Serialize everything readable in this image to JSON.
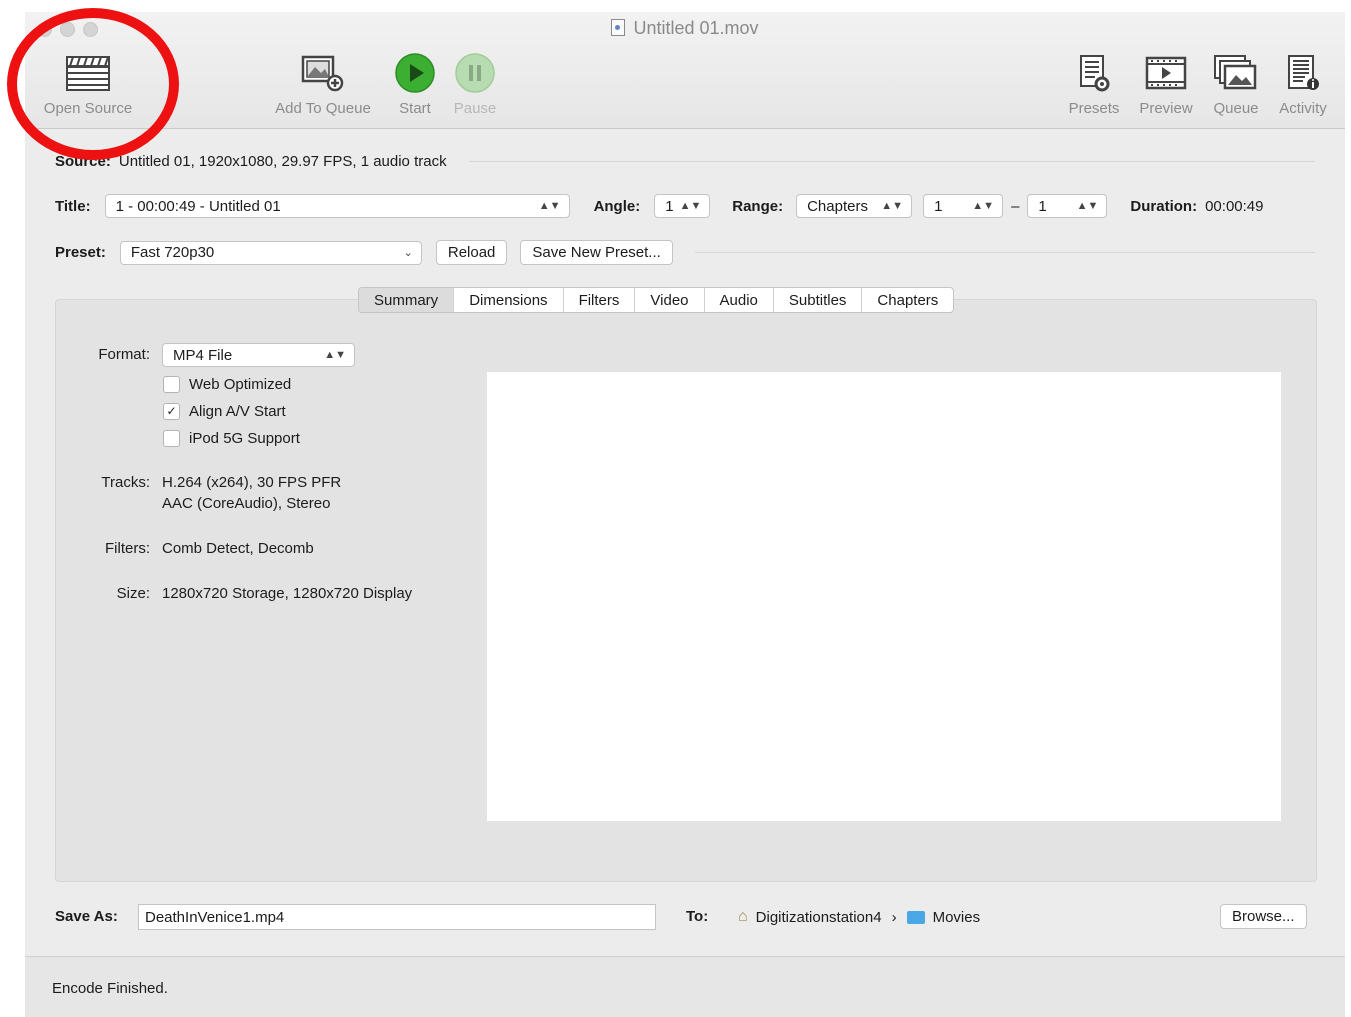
{
  "window": {
    "title": "Untitled 01.mov"
  },
  "toolbar": {
    "open_source": "Open Source",
    "add_to_queue": "Add To Queue",
    "start": "Start",
    "pause": "Pause",
    "presets": "Presets",
    "preview": "Preview",
    "queue": "Queue",
    "activity": "Activity"
  },
  "source": {
    "label": "Source:",
    "text": "Untitled 01, 1920x1080, 29.97 FPS, 1 audio track"
  },
  "title_row": {
    "title_label": "Title:",
    "title_value": "1 - 00:00:49 - Untitled 01",
    "angle_label": "Angle:",
    "angle_value": "1",
    "range_label": "Range:",
    "range_value": "Chapters",
    "range_start": "1",
    "range_dash": "–",
    "range_end": "1",
    "duration_label": "Duration:",
    "duration_value": "00:00:49"
  },
  "preset_row": {
    "preset_label": "Preset:",
    "preset_value": "Fast 720p30",
    "reload": "Reload",
    "save_new_preset": "Save New Preset..."
  },
  "tabs": [
    "Summary",
    "Dimensions",
    "Filters",
    "Video",
    "Audio",
    "Subtitles",
    "Chapters"
  ],
  "active_tab": "Summary",
  "summary": {
    "format_label": "Format:",
    "format_value": "MP4 File",
    "web_optimized": {
      "label": "Web Optimized",
      "checked": false
    },
    "align_av": {
      "label": "Align A/V Start",
      "checked": true
    },
    "ipod": {
      "label": "iPod 5G Support",
      "checked": false
    },
    "tracks_label": "Tracks:",
    "tracks_line1": "H.264 (x264), 30 FPS PFR",
    "tracks_line2": "AAC (CoreAudio), Stereo",
    "filters_label": "Filters:",
    "filters_value": "Comb Detect, Decomb",
    "size_label": "Size:",
    "size_value": "1280x720 Storage, 1280x720 Display"
  },
  "save": {
    "save_as_label": "Save As:",
    "save_as_value": "DeathInVenice1.mp4",
    "to_label": "To:",
    "path_home": "Digitizationstation4",
    "path_sep": "›",
    "path_folder": "Movies",
    "browse": "Browse..."
  },
  "status": "Encode Finished.",
  "colors": {
    "annotation": "#ee1111",
    "start_green": "#3cae32",
    "folder_blue": "#4aa8e6"
  },
  "icons": {
    "open_source": "clapperboard-icon",
    "add_to_queue": "image-plus-icon",
    "start": "play-icon",
    "pause": "pause-icon",
    "presets": "document-gear-icon",
    "preview": "film-icon",
    "queue": "stacked-images-icon",
    "activity": "log-info-icon"
  }
}
